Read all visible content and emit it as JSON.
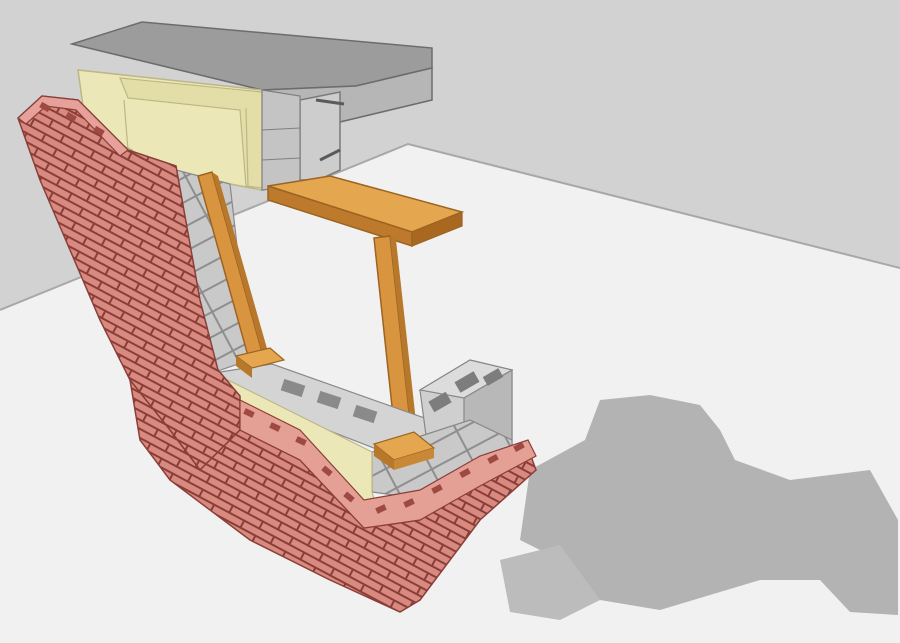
{
  "scene": {
    "subject": "masonry-wall-cutaway",
    "colors": {
      "floor": "#f2f2f2",
      "wall_back": "#cfcfcf",
      "shadow": "#b4b4b4",
      "brick": "#d9897f",
      "brick_dark": "#a9544c",
      "brick_mortar": "#8a3e38",
      "cmu": "#cbcbcb",
      "cmu_dark": "#9a9a9a",
      "insulation": "#eeeabb",
      "insulation_dark": "#c9c38c",
      "concrete": "#999999",
      "concrete_dark": "#777777",
      "timber": "#d9963f",
      "timber_dark": "#a56a22"
    }
  }
}
